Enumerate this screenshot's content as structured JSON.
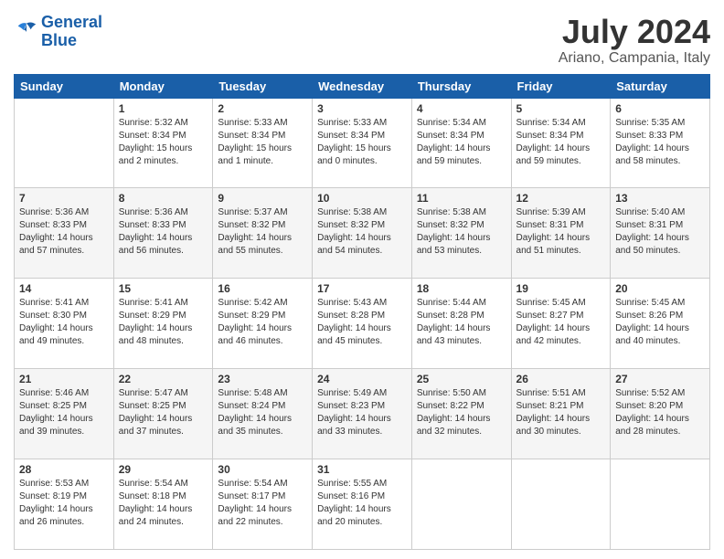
{
  "logo": {
    "text_general": "General",
    "text_blue": "Blue"
  },
  "header": {
    "title": "July 2024",
    "subtitle": "Ariano, Campania, Italy"
  },
  "weekdays": [
    "Sunday",
    "Monday",
    "Tuesday",
    "Wednesday",
    "Thursday",
    "Friday",
    "Saturday"
  ],
  "weeks": [
    [
      {
        "num": "",
        "sunrise": "",
        "sunset": "",
        "daylight": ""
      },
      {
        "num": "1",
        "sunrise": "Sunrise: 5:32 AM",
        "sunset": "Sunset: 8:34 PM",
        "daylight": "Daylight: 15 hours and 2 minutes."
      },
      {
        "num": "2",
        "sunrise": "Sunrise: 5:33 AM",
        "sunset": "Sunset: 8:34 PM",
        "daylight": "Daylight: 15 hours and 1 minute."
      },
      {
        "num": "3",
        "sunrise": "Sunrise: 5:33 AM",
        "sunset": "Sunset: 8:34 PM",
        "daylight": "Daylight: 15 hours and 0 minutes."
      },
      {
        "num": "4",
        "sunrise": "Sunrise: 5:34 AM",
        "sunset": "Sunset: 8:34 PM",
        "daylight": "Daylight: 14 hours and 59 minutes."
      },
      {
        "num": "5",
        "sunrise": "Sunrise: 5:34 AM",
        "sunset": "Sunset: 8:34 PM",
        "daylight": "Daylight: 14 hours and 59 minutes."
      },
      {
        "num": "6",
        "sunrise": "Sunrise: 5:35 AM",
        "sunset": "Sunset: 8:33 PM",
        "daylight": "Daylight: 14 hours and 58 minutes."
      }
    ],
    [
      {
        "num": "7",
        "sunrise": "Sunrise: 5:36 AM",
        "sunset": "Sunset: 8:33 PM",
        "daylight": "Daylight: 14 hours and 57 minutes."
      },
      {
        "num": "8",
        "sunrise": "Sunrise: 5:36 AM",
        "sunset": "Sunset: 8:33 PM",
        "daylight": "Daylight: 14 hours and 56 minutes."
      },
      {
        "num": "9",
        "sunrise": "Sunrise: 5:37 AM",
        "sunset": "Sunset: 8:32 PM",
        "daylight": "Daylight: 14 hours and 55 minutes."
      },
      {
        "num": "10",
        "sunrise": "Sunrise: 5:38 AM",
        "sunset": "Sunset: 8:32 PM",
        "daylight": "Daylight: 14 hours and 54 minutes."
      },
      {
        "num": "11",
        "sunrise": "Sunrise: 5:38 AM",
        "sunset": "Sunset: 8:32 PM",
        "daylight": "Daylight: 14 hours and 53 minutes."
      },
      {
        "num": "12",
        "sunrise": "Sunrise: 5:39 AM",
        "sunset": "Sunset: 8:31 PM",
        "daylight": "Daylight: 14 hours and 51 minutes."
      },
      {
        "num": "13",
        "sunrise": "Sunrise: 5:40 AM",
        "sunset": "Sunset: 8:31 PM",
        "daylight": "Daylight: 14 hours and 50 minutes."
      }
    ],
    [
      {
        "num": "14",
        "sunrise": "Sunrise: 5:41 AM",
        "sunset": "Sunset: 8:30 PM",
        "daylight": "Daylight: 14 hours and 49 minutes."
      },
      {
        "num": "15",
        "sunrise": "Sunrise: 5:41 AM",
        "sunset": "Sunset: 8:29 PM",
        "daylight": "Daylight: 14 hours and 48 minutes."
      },
      {
        "num": "16",
        "sunrise": "Sunrise: 5:42 AM",
        "sunset": "Sunset: 8:29 PM",
        "daylight": "Daylight: 14 hours and 46 minutes."
      },
      {
        "num": "17",
        "sunrise": "Sunrise: 5:43 AM",
        "sunset": "Sunset: 8:28 PM",
        "daylight": "Daylight: 14 hours and 45 minutes."
      },
      {
        "num": "18",
        "sunrise": "Sunrise: 5:44 AM",
        "sunset": "Sunset: 8:28 PM",
        "daylight": "Daylight: 14 hours and 43 minutes."
      },
      {
        "num": "19",
        "sunrise": "Sunrise: 5:45 AM",
        "sunset": "Sunset: 8:27 PM",
        "daylight": "Daylight: 14 hours and 42 minutes."
      },
      {
        "num": "20",
        "sunrise": "Sunrise: 5:45 AM",
        "sunset": "Sunset: 8:26 PM",
        "daylight": "Daylight: 14 hours and 40 minutes."
      }
    ],
    [
      {
        "num": "21",
        "sunrise": "Sunrise: 5:46 AM",
        "sunset": "Sunset: 8:25 PM",
        "daylight": "Daylight: 14 hours and 39 minutes."
      },
      {
        "num": "22",
        "sunrise": "Sunrise: 5:47 AM",
        "sunset": "Sunset: 8:25 PM",
        "daylight": "Daylight: 14 hours and 37 minutes."
      },
      {
        "num": "23",
        "sunrise": "Sunrise: 5:48 AM",
        "sunset": "Sunset: 8:24 PM",
        "daylight": "Daylight: 14 hours and 35 minutes."
      },
      {
        "num": "24",
        "sunrise": "Sunrise: 5:49 AM",
        "sunset": "Sunset: 8:23 PM",
        "daylight": "Daylight: 14 hours and 33 minutes."
      },
      {
        "num": "25",
        "sunrise": "Sunrise: 5:50 AM",
        "sunset": "Sunset: 8:22 PM",
        "daylight": "Daylight: 14 hours and 32 minutes."
      },
      {
        "num": "26",
        "sunrise": "Sunrise: 5:51 AM",
        "sunset": "Sunset: 8:21 PM",
        "daylight": "Daylight: 14 hours and 30 minutes."
      },
      {
        "num": "27",
        "sunrise": "Sunrise: 5:52 AM",
        "sunset": "Sunset: 8:20 PM",
        "daylight": "Daylight: 14 hours and 28 minutes."
      }
    ],
    [
      {
        "num": "28",
        "sunrise": "Sunrise: 5:53 AM",
        "sunset": "Sunset: 8:19 PM",
        "daylight": "Daylight: 14 hours and 26 minutes."
      },
      {
        "num": "29",
        "sunrise": "Sunrise: 5:54 AM",
        "sunset": "Sunset: 8:18 PM",
        "daylight": "Daylight: 14 hours and 24 minutes."
      },
      {
        "num": "30",
        "sunrise": "Sunrise: 5:54 AM",
        "sunset": "Sunset: 8:17 PM",
        "daylight": "Daylight: 14 hours and 22 minutes."
      },
      {
        "num": "31",
        "sunrise": "Sunrise: 5:55 AM",
        "sunset": "Sunset: 8:16 PM",
        "daylight": "Daylight: 14 hours and 20 minutes."
      },
      {
        "num": "",
        "sunrise": "",
        "sunset": "",
        "daylight": ""
      },
      {
        "num": "",
        "sunrise": "",
        "sunset": "",
        "daylight": ""
      },
      {
        "num": "",
        "sunrise": "",
        "sunset": "",
        "daylight": ""
      }
    ]
  ]
}
